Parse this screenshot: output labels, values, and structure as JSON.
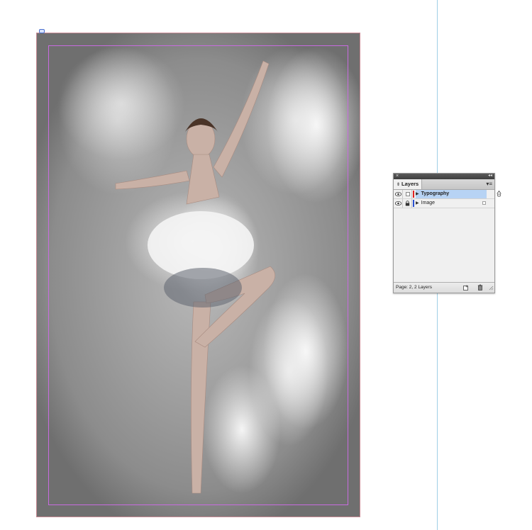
{
  "document": {
    "placed_image_subject": "dancer-in-powder-cloud"
  },
  "layers_panel": {
    "tab_label": "Layers",
    "menu_glyph": "▾≡",
    "layers": [
      {
        "name": "Typography",
        "visible": true,
        "locked": false,
        "selected": true,
        "color": "#e02020"
      },
      {
        "name": "Image",
        "visible": true,
        "locked": true,
        "selected": false,
        "color": "#2a50d0"
      }
    ],
    "footer_status": "Page: 2, 2 Layers",
    "icons": {
      "close": "close-icon",
      "collapse": "collapse-icon",
      "visibility": "eye-icon",
      "lock": "lock-icon",
      "target": "pen-target-icon",
      "new_layer": "new-layer-icon",
      "delete": "trash-icon"
    }
  }
}
